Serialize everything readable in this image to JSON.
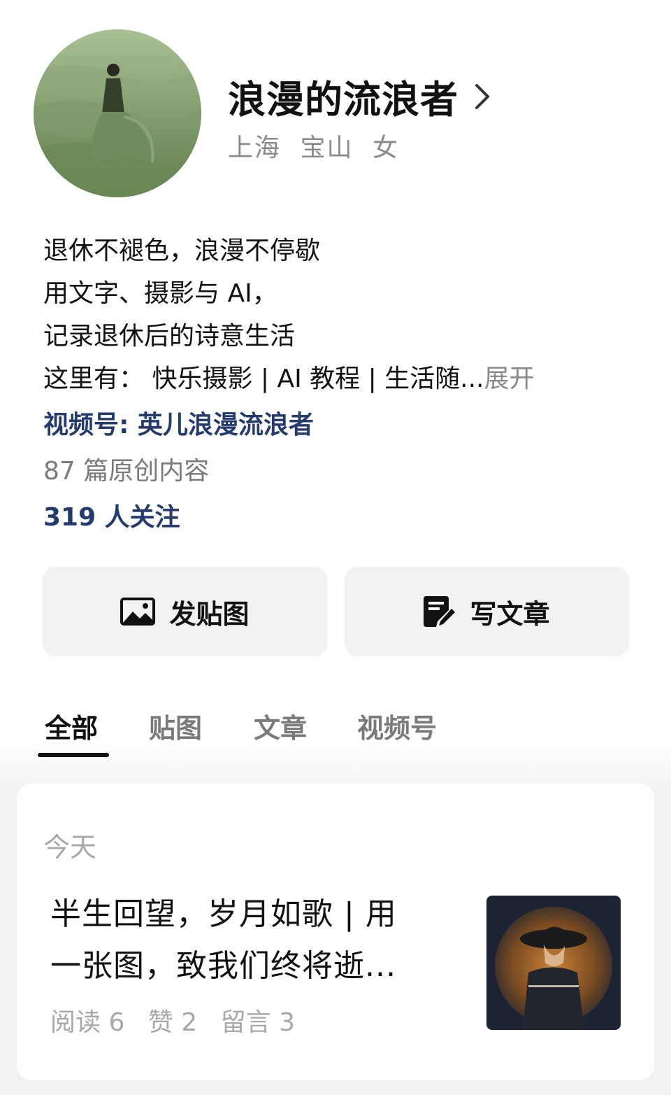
{
  "profile": {
    "name": "浪漫的流浪者",
    "location": [
      "上海",
      "宝山",
      "女"
    ],
    "bio_lines": [
      "退休不褪色，浪漫不停歇",
      "用文字、摄影与 AI，",
      "记录退休后的诗意生活",
      "这里有： 快乐摄影 |  AI 教程 | 生活随..."
    ],
    "expand_label": "展开",
    "channel_link": "视频号: 英儿浪漫流浪者",
    "original_count": "87 篇原创内容",
    "followers": "319 人关注"
  },
  "actions": {
    "post_image_label": "发贴图",
    "write_article_label": "写文章"
  },
  "tabs": [
    "全部",
    "贴图",
    "文章",
    "视频号"
  ],
  "active_tab": "全部",
  "feed": {
    "date_label": "今天",
    "article": {
      "title_lines": [
        "半生回望，岁月如歌 | 用",
        "一张图，致我们终将逝..."
      ],
      "stats": [
        "阅读 6",
        "赞 2",
        "留言 3"
      ]
    }
  },
  "colors": {
    "link_blue": "#243b6b",
    "muted_gray": "#8a8a8a",
    "button_bg": "#f2f2f2"
  }
}
